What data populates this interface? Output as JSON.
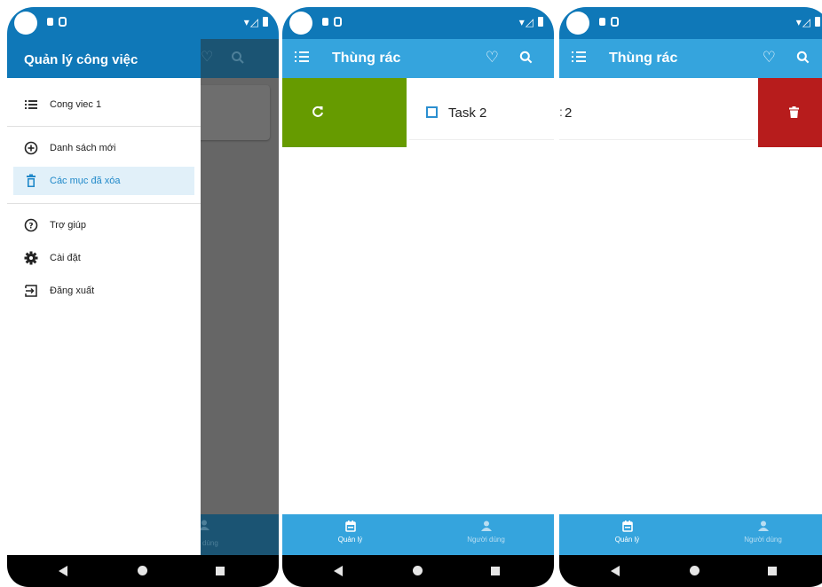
{
  "screens": {
    "drawer": {
      "title": "Quản lý công việc",
      "items": [
        {
          "label": "Cong viec 1",
          "icon": "list-icon"
        },
        {
          "label": "Danh sách mới",
          "icon": "add-circle-icon"
        },
        {
          "label": "Các mục đã xóa",
          "icon": "trash-icon",
          "active": true
        },
        {
          "label": "Trợ giúp",
          "icon": "help-icon"
        },
        {
          "label": "Cài đặt",
          "icon": "gear-icon"
        },
        {
          "label": "Đăng xuất",
          "icon": "logout-icon"
        }
      ],
      "dim_tab_label": "dùng"
    },
    "trash_restore": {
      "title": "Thùng rác",
      "task": "Task 2"
    },
    "trash_delete": {
      "title": "Thùng rác",
      "task_fragment": "2"
    }
  },
  "bottom_nav": {
    "manage_label": "Quản lý",
    "users_label": "Người dùng"
  },
  "colors": {
    "primary": "#35a4dd",
    "status_bar": "#0f78b8",
    "restore_green": "#669b00",
    "delete_red": "#b71c1c",
    "active_item": "#1f88c9"
  }
}
